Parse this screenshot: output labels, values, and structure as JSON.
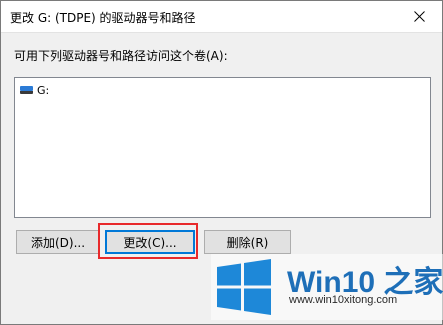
{
  "window": {
    "title": "更改 G: (TDPE) 的驱动器号和路径"
  },
  "prompt": "可用下列驱动器号和路径访问这个卷(A):",
  "list": {
    "items": [
      {
        "label": "G:",
        "icon": "drive-icon"
      }
    ]
  },
  "buttons": {
    "add": "添加(D)...",
    "change": "更改(C)...",
    "remove": "删除(R)"
  },
  "watermark": {
    "brand": "Win10 之家",
    "url": "www.win10xitong.com"
  },
  "colors": {
    "highlight": "#e8292b",
    "accent": "#0078d7",
    "brand": "#1e6fb8"
  }
}
